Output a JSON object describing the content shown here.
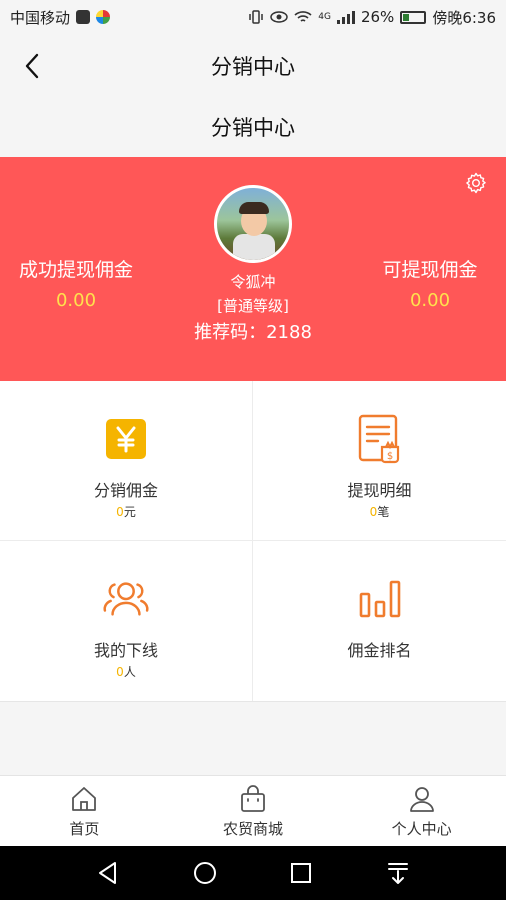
{
  "status_bar": {
    "carrier": "中国移动",
    "network": "4G",
    "battery": "26%",
    "time": "傍晚6:36"
  },
  "nav": {
    "title": "分销中心",
    "back_icon": "chevron-left-icon"
  },
  "subtitle": "分销中心",
  "profile": {
    "name": "令狐冲",
    "level": "[普通等级]",
    "referral": "推荐码：2188",
    "left_stat": {
      "label": "成功提现佣金",
      "value": "0.00"
    },
    "right_stat": {
      "label": "可提现佣金",
      "value": "0.00"
    },
    "settings_icon": "gear-icon",
    "colors": {
      "background": "#ff5757",
      "value": "#ffe14d"
    }
  },
  "grid": [
    {
      "title": "分销佣金",
      "count": "0",
      "unit": "元",
      "icon": "yen-icon",
      "color": "#f5b400"
    },
    {
      "title": "提现明细",
      "count": "0",
      "unit": "笔",
      "icon": "document-dollar-icon",
      "color": "#f07c2e"
    },
    {
      "title": "我的下线",
      "count": "0",
      "unit": "人",
      "icon": "users-icon",
      "color": "#f07c2e"
    },
    {
      "title": "佣金排名",
      "icon": "bar-chart-icon",
      "color": "#f07c2e"
    }
  ],
  "tabbar": [
    {
      "label": "首页",
      "icon": "home-icon"
    },
    {
      "label": "农贸商城",
      "icon": "shopping-bag-icon"
    },
    {
      "label": "个人中心",
      "icon": "user-icon"
    }
  ]
}
